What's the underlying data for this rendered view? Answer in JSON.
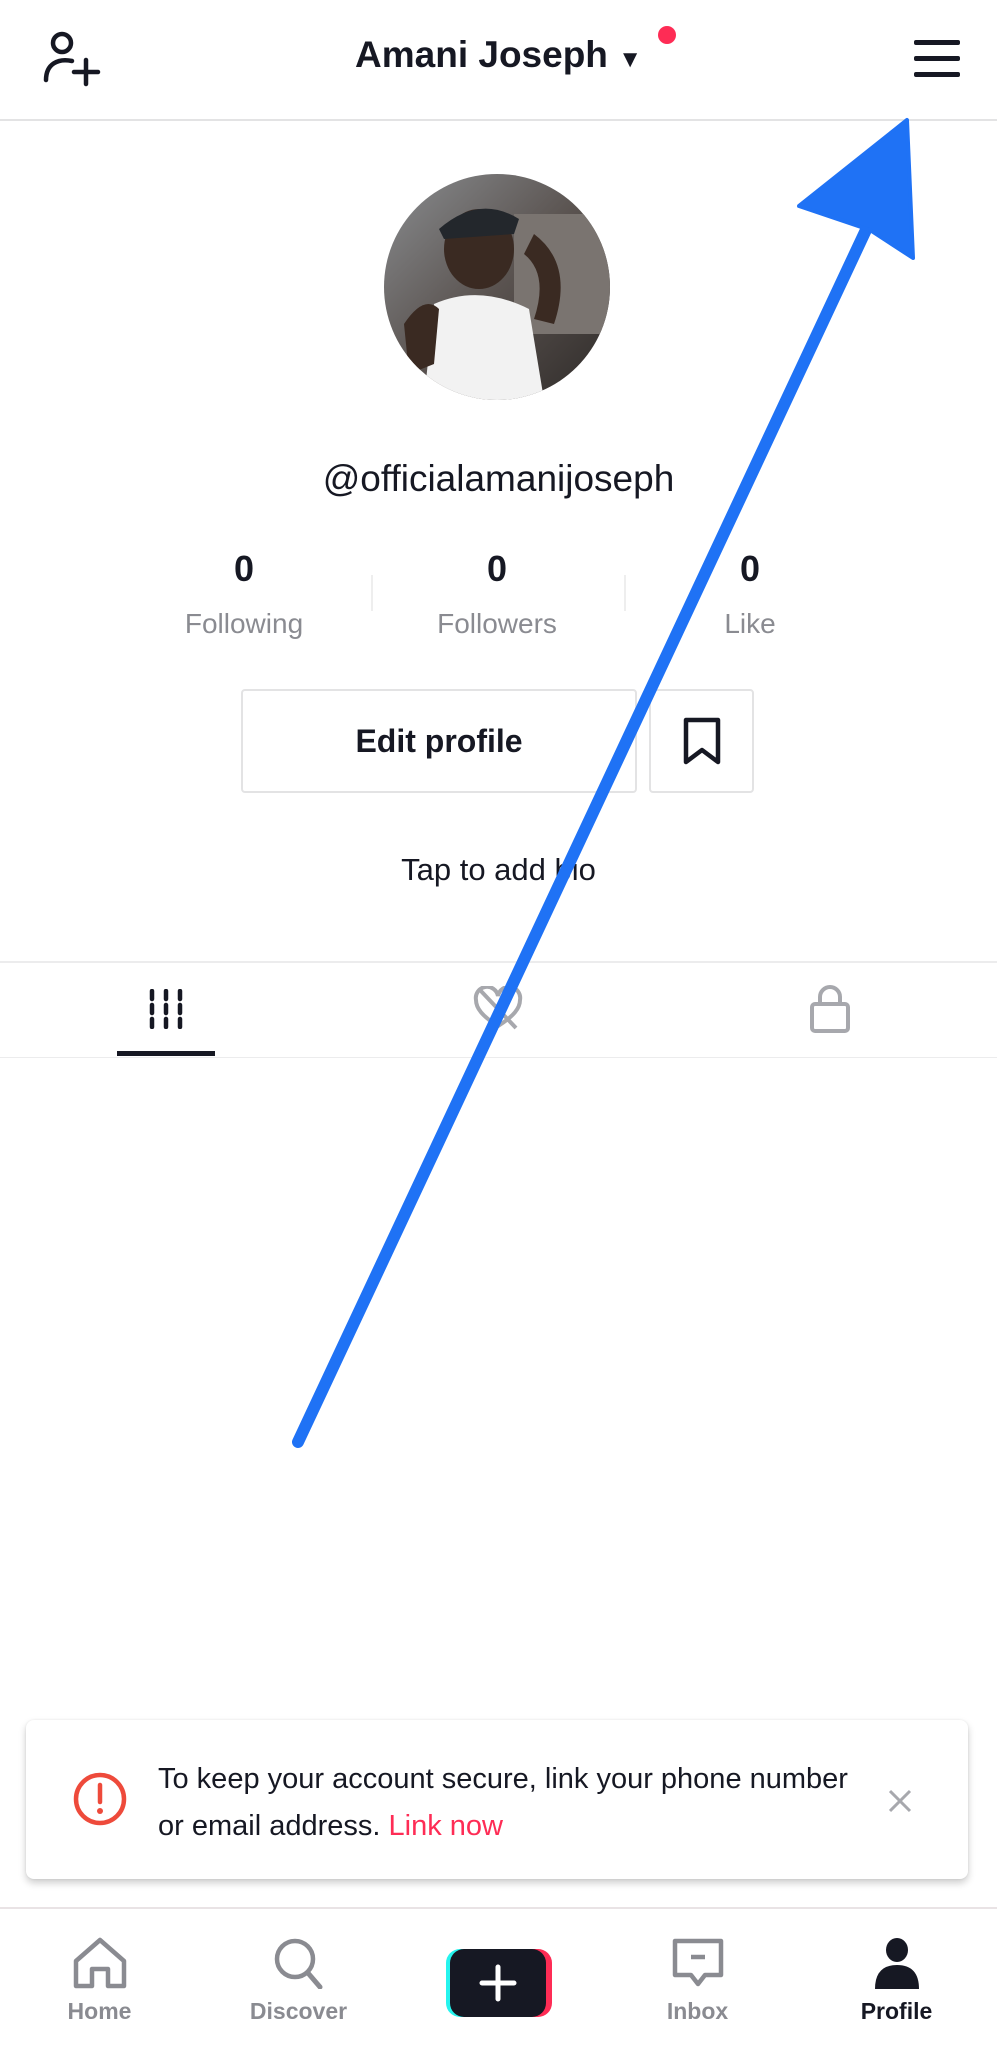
{
  "header": {
    "title": "Amani Joseph",
    "add_user_icon": "person-plus-icon",
    "menu_icon": "hamburger-icon",
    "dropdown_icon": "caret-down-icon",
    "notification_color": "#fe2c55"
  },
  "profile": {
    "username": "@officialamanijoseph",
    "stats": [
      {
        "value": "0",
        "label": "Following"
      },
      {
        "value": "0",
        "label": "Followers"
      },
      {
        "value": "0",
        "label": "Like"
      }
    ],
    "edit_label": "Edit profile",
    "bookmark_icon": "bookmark-icon",
    "bio_placeholder": "Tap to add bio"
  },
  "tabs": [
    {
      "icon": "grid-icon",
      "active": true
    },
    {
      "icon": "liked-hidden-icon",
      "active": false
    },
    {
      "icon": "lock-icon",
      "active": false
    }
  ],
  "banner": {
    "icon": "alert-circle-icon",
    "text": "To keep your account secure, link your phone number or email address.",
    "link": "Link now",
    "close_icon": "close-icon",
    "accent": "#fe2c55"
  },
  "nav": [
    {
      "label": "Home",
      "icon": "home-icon"
    },
    {
      "label": "Discover",
      "icon": "search-icon"
    },
    {
      "label": "",
      "icon": "create-plus-icon"
    },
    {
      "label": "Inbox",
      "icon": "inbox-icon"
    },
    {
      "label": "Profile",
      "icon": "profile-icon",
      "active": true
    }
  ],
  "annotation": {
    "color": "#1f72f5",
    "icon": "arrow-annotation"
  }
}
